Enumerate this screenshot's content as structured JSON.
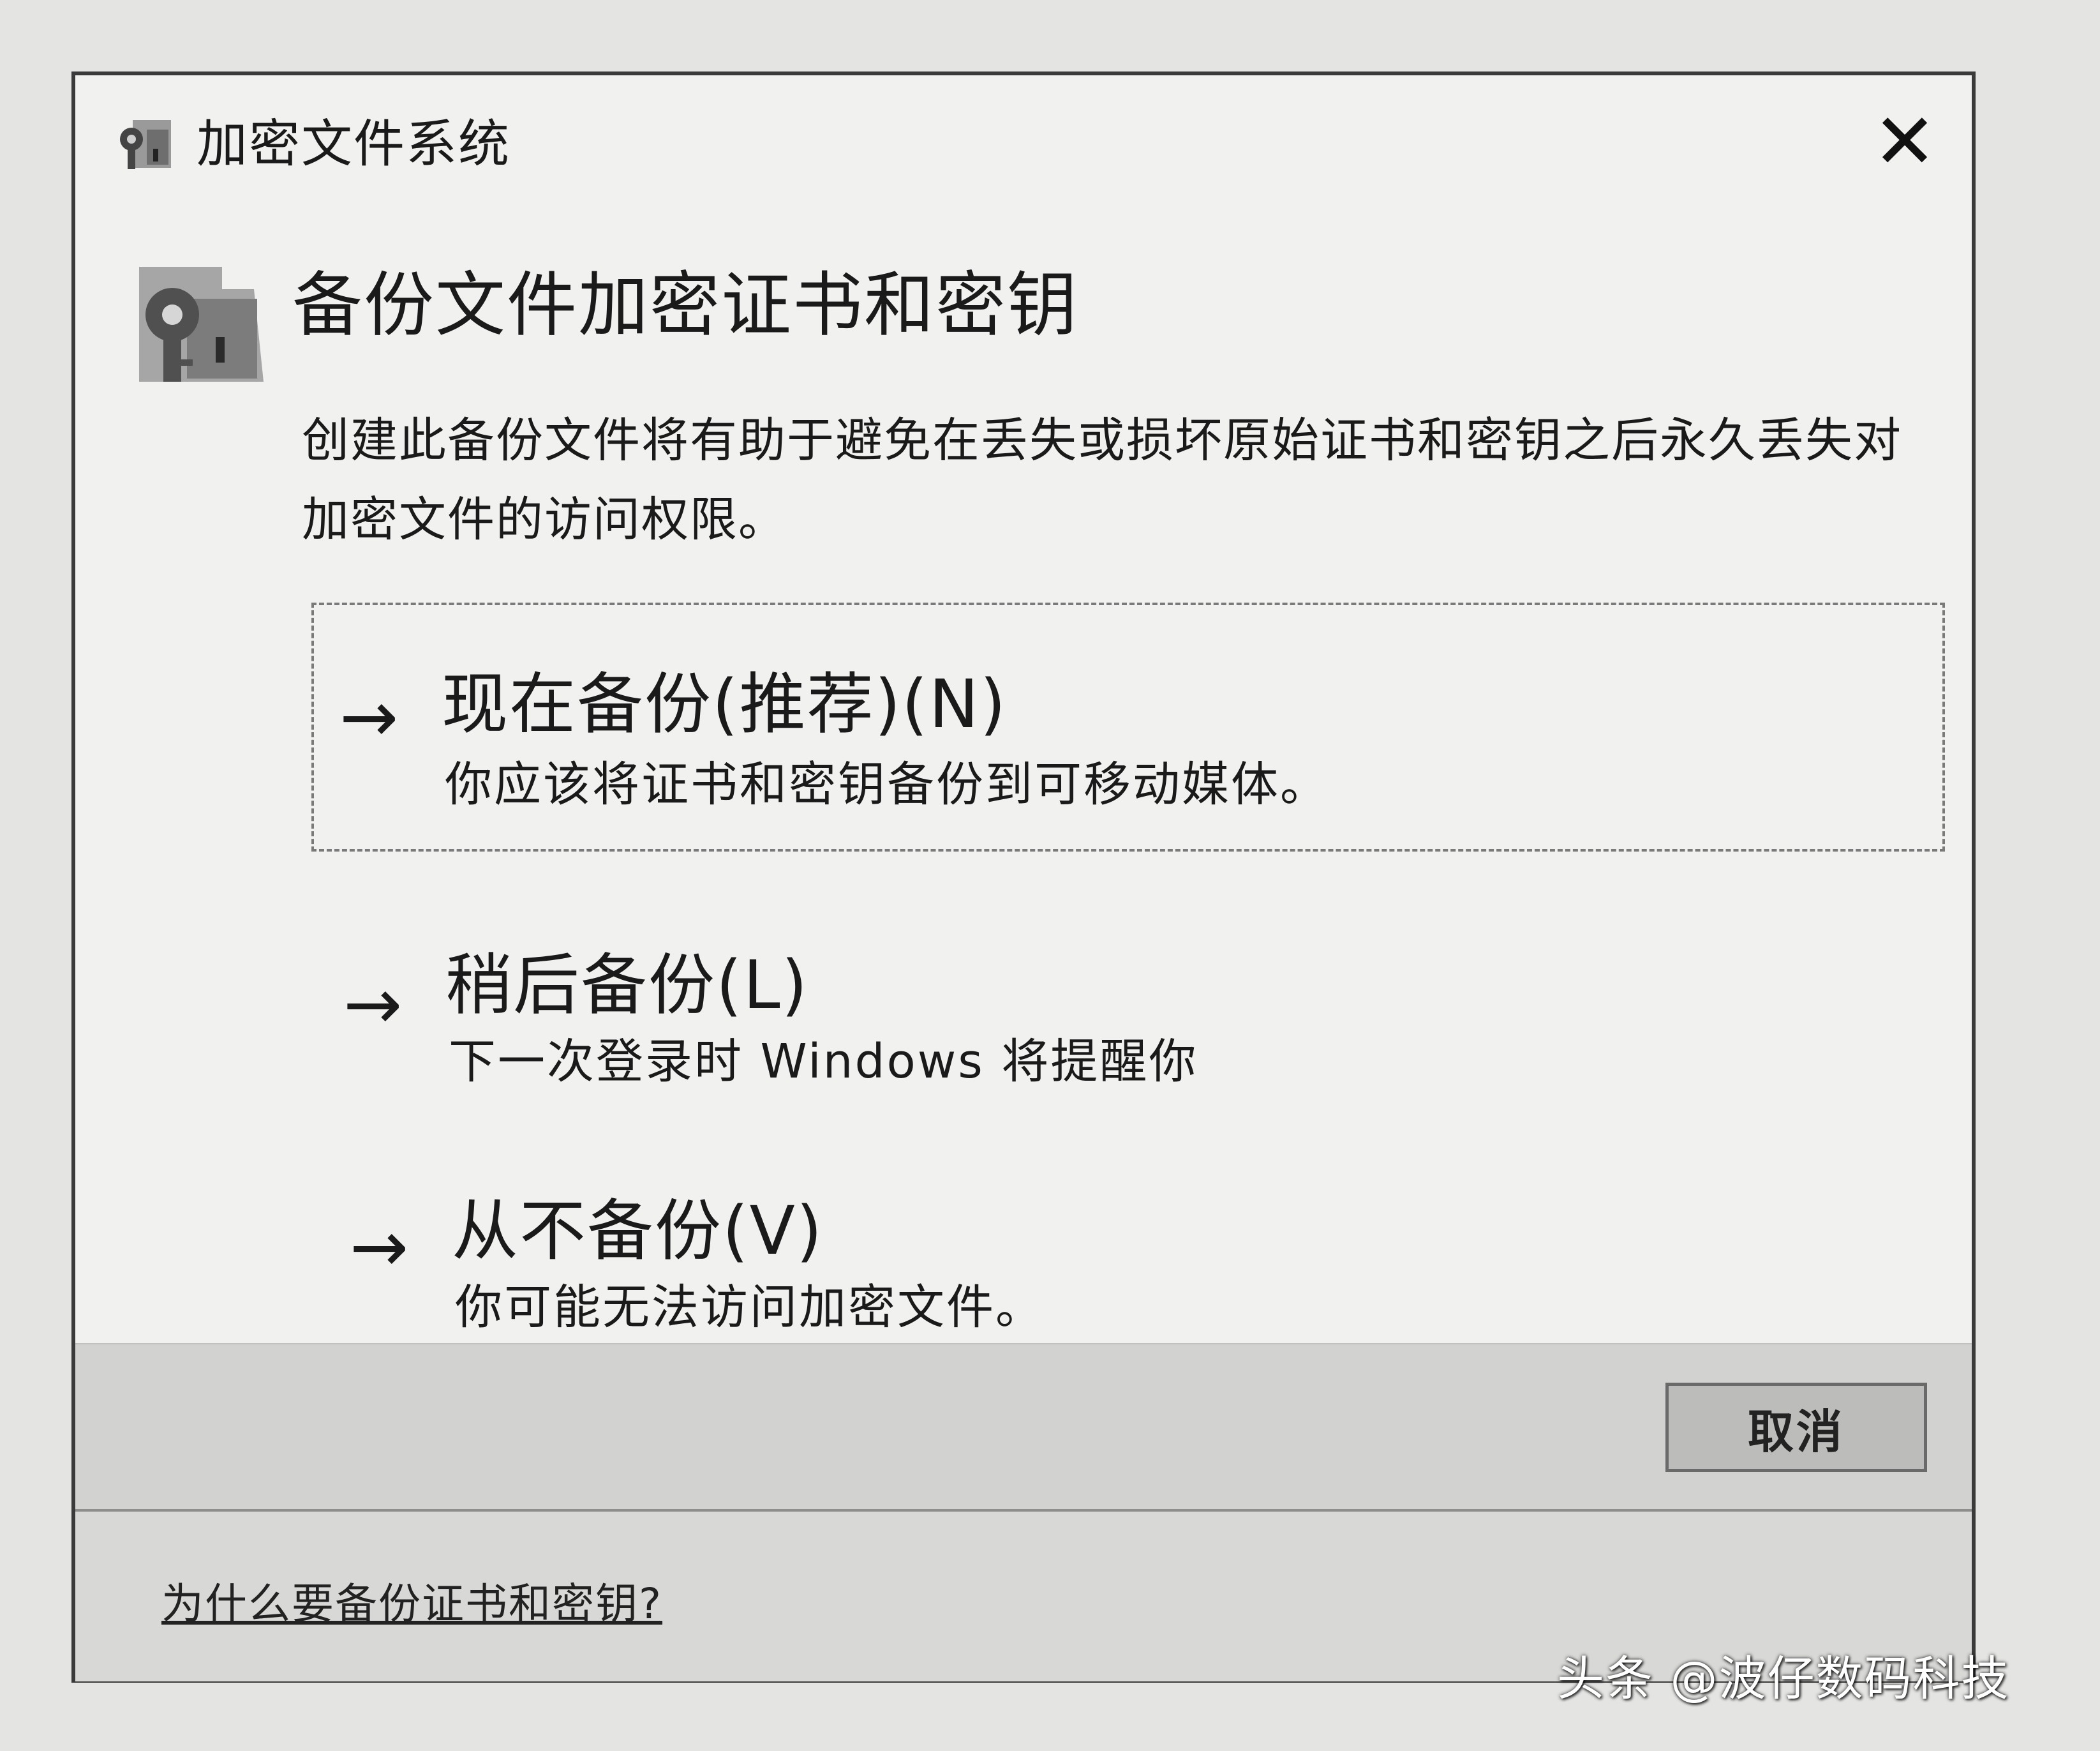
{
  "window": {
    "title": "加密文件系统",
    "title_icon": "efs-key-icon",
    "close_icon": "close-icon",
    "close_glyph": "✕"
  },
  "header": {
    "icon": "certificate-key-icon",
    "title": "备份文件加密证书和密钥",
    "description": "创建此备份文件将有助于避免在丢失或损坏原始证书和密钥之后永久丢失对加密文件的访问权限。"
  },
  "options": [
    {
      "arrow_icon": "arrow-right-icon",
      "arrow": "→",
      "title": "现在备份(推荐)(N)",
      "subtitle": "你应该将证书和密钥备份到可移动媒体。"
    },
    {
      "arrow_icon": "arrow-right-icon",
      "arrow": "→",
      "title": "稍后备份(L)",
      "subtitle": "下一次登录时 Windows 将提醒你"
    },
    {
      "arrow_icon": "arrow-right-icon",
      "arrow": "→",
      "title": "从不备份(V)",
      "subtitle": "你可能无法访问加密文件。"
    }
  ],
  "footer": {
    "cancel_label": "取消",
    "help_link": "为什么要备份证书和密钥?"
  },
  "watermark": "头条 @波仔数码科技"
}
